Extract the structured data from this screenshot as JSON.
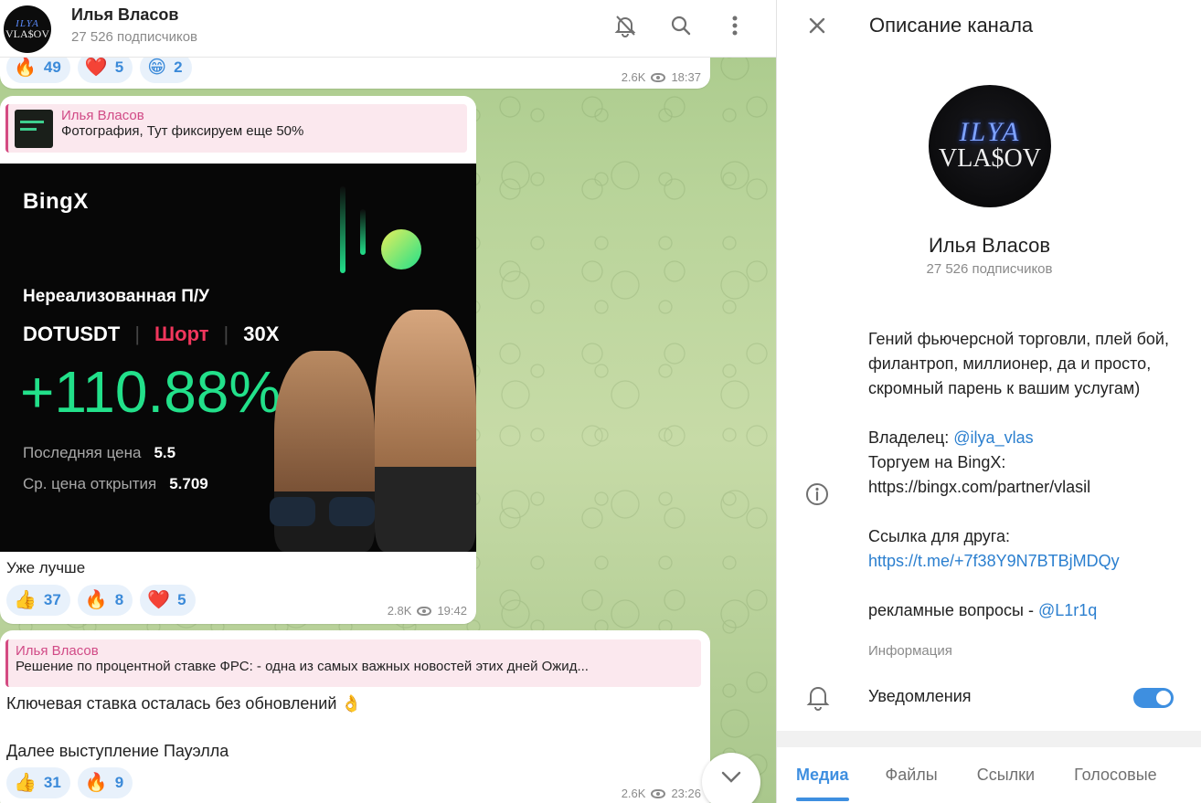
{
  "header": {
    "avatar_line1": "ILYA",
    "avatar_line2": "VLA$OV",
    "title": "Илья Власов",
    "subscribers": "27 526 подписчиков",
    "icons": [
      "mute-bell-icon",
      "search-icon",
      "more-vertical-icon"
    ]
  },
  "messages": [
    {
      "reactions": [
        {
          "emoji": "🔥",
          "count": "49"
        },
        {
          "emoji": "❤️",
          "count": "5"
        },
        {
          "emoji": "😁",
          "count": "2"
        }
      ],
      "views": "2.6K",
      "time": "18:37"
    },
    {
      "reply_name": "Илья Власов",
      "reply_text": "Фотография, Тут фиксируем еще 50%",
      "card": {
        "brand": "BingX",
        "label": "Нереализованная П/У",
        "pair": "DOTUSDT",
        "side": "Шорт",
        "leverage": "30X",
        "pnl": "+110.88%",
        "last_price_label": "Последняя цена",
        "last_price": "5.5",
        "open_price_label": "Ср. цена открытия",
        "open_price": "5.709"
      },
      "caption": "Уже лучше",
      "reactions": [
        {
          "emoji": "👍",
          "count": "37"
        },
        {
          "emoji": "🔥",
          "count": "8"
        },
        {
          "emoji": "❤️",
          "count": "5"
        }
      ],
      "views": "2.8K",
      "time": "19:42"
    },
    {
      "reply_name": "Илья Власов",
      "reply_text": "Решение по процентной ставке ФРС: - одна из самых важных новостей этих дней Ожид...",
      "line1": "Ключевая ставка осталась без обновлений 👌",
      "line2": "Далее выступление Пауэлла",
      "reactions": [
        {
          "emoji": "👍",
          "count": "31"
        },
        {
          "emoji": "🔥",
          "count": "9"
        }
      ],
      "views": "2.6K",
      "time": "23:26"
    }
  ],
  "panel": {
    "title": "Описание канала",
    "avatar_line1": "ILYA",
    "avatar_line2": "VLA$OV",
    "name": "Илья Власов",
    "subscribers": "27 526 подписчиков",
    "description": {
      "p1": "Гений фьючерсной торговли, плей бой, филантроп, миллионер, да и просто, скромный парень к вашим услугам)",
      "owner_label": "Владелец:",
      "owner_link": "@ilya_vlas",
      "trade_label": "Торгуем на BingX:",
      "trade_url": "https://bingx.com/partner/vlasil",
      "friend_label": "Ссылка для друга:",
      "friend_url": "https://t.me/+7f38Y9N7BTBjMDQy",
      "ads_label": "рекламные вопросы -",
      "ads_link": "@L1r1q"
    },
    "info_label": "Информация",
    "notifications_label": "Уведомления",
    "notifications_on": true,
    "tabs": [
      "Медиа",
      "Файлы",
      "Ссылки",
      "Голосовые"
    ],
    "active_tab": "Медиа"
  },
  "colors": {
    "accent": "#3e8fe0",
    "reply_name": "#d14a86",
    "pnl_green": "#22e08a",
    "short_red": "#f0365c"
  }
}
